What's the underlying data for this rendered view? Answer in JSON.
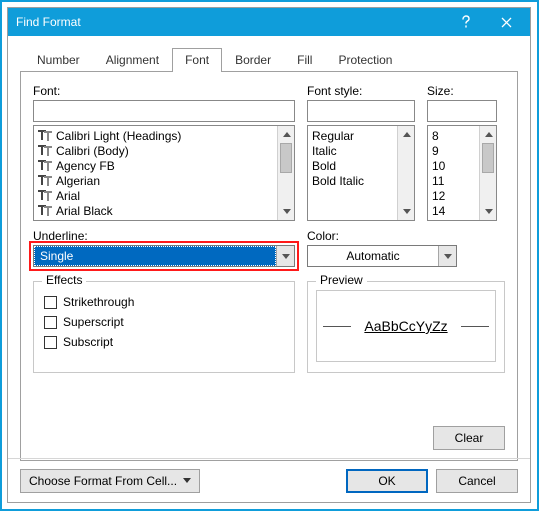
{
  "title": "Find Format",
  "tabs": [
    "Number",
    "Alignment",
    "Font",
    "Border",
    "Fill",
    "Protection"
  ],
  "active_tab": 2,
  "labels": {
    "font": "Font:",
    "font_style": "Font style:",
    "size": "Size:",
    "underline": "Underline:",
    "color": "Color:",
    "effects": "Effects",
    "preview": "Preview"
  },
  "font_list": [
    "Calibri Light (Headings)",
    "Calibri (Body)",
    "Agency FB",
    "Algerian",
    "Arial",
    "Arial Black"
  ],
  "style_list": [
    "Regular",
    "Italic",
    "Bold",
    "Bold Italic"
  ],
  "size_list": [
    "8",
    "9",
    "10",
    "11",
    "12",
    "14"
  ],
  "underline_value": "Single",
  "color_value": "Automatic",
  "effects": {
    "strikethrough": "Strikethrough",
    "superscript": "Superscript",
    "subscript": "Subscript"
  },
  "preview_text": "AaBbCcYyZz",
  "buttons": {
    "clear": "Clear",
    "choose_from_cell": "Choose Format From Cell...",
    "ok": "OK",
    "cancel": "Cancel"
  }
}
